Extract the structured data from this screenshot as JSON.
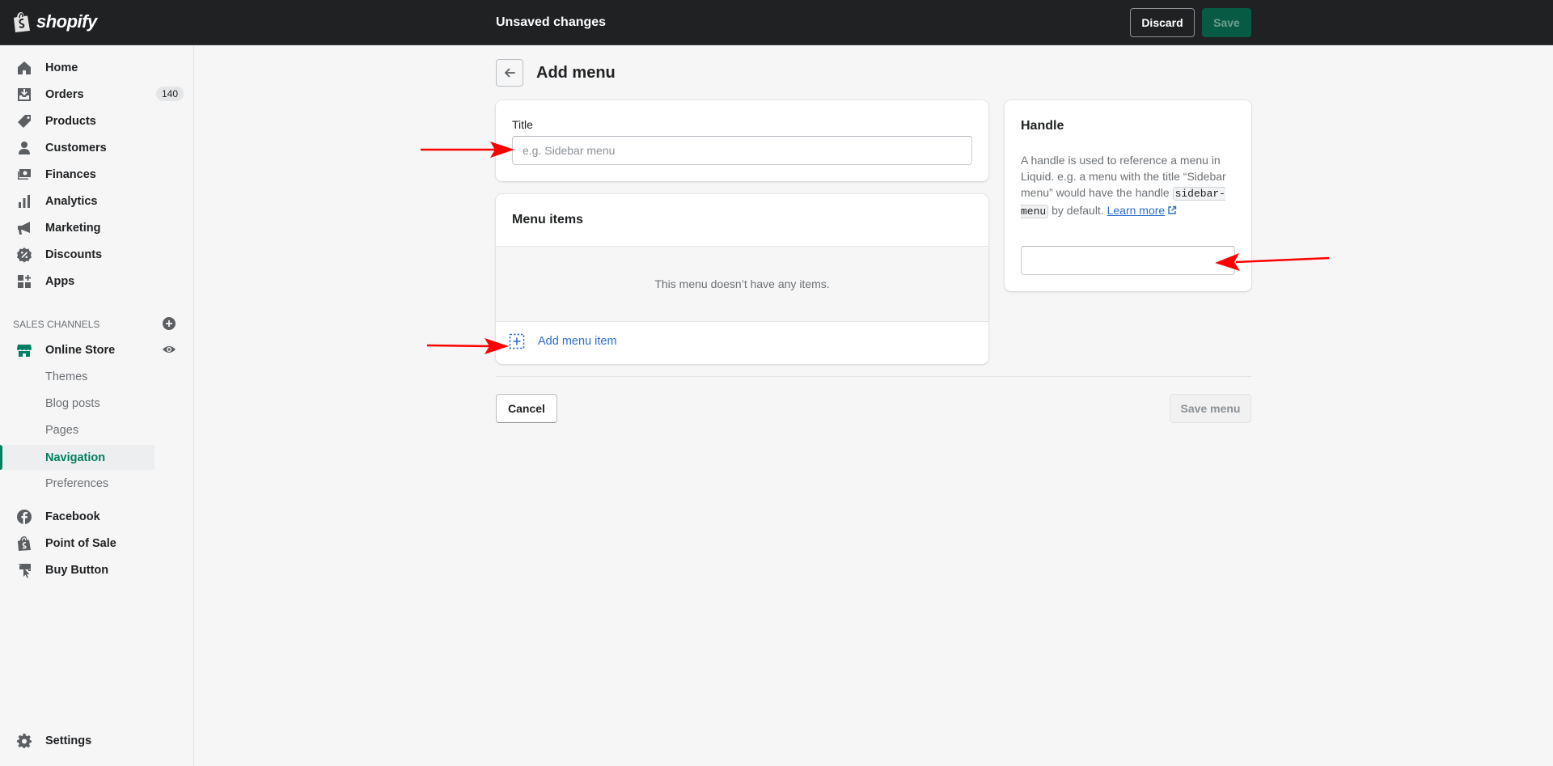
{
  "topbar": {
    "logo_text": "shopify",
    "status_text": "Unsaved changes",
    "discard_label": "Discard",
    "save_label": "Save"
  },
  "sidebar": {
    "items": [
      {
        "label": "Home",
        "icon": "home-icon"
      },
      {
        "label": "Orders",
        "icon": "orders-icon",
        "badge": "140"
      },
      {
        "label": "Products",
        "icon": "tag-icon"
      },
      {
        "label": "Customers",
        "icon": "person-icon"
      },
      {
        "label": "Finances",
        "icon": "finances-icon"
      },
      {
        "label": "Analytics",
        "icon": "bar-chart-icon"
      },
      {
        "label": "Marketing",
        "icon": "megaphone-icon"
      },
      {
        "label": "Discounts",
        "icon": "discount-icon"
      },
      {
        "label": "Apps",
        "icon": "apps-icon"
      }
    ],
    "sales_channels_title": "SALES CHANNELS",
    "online_store": {
      "label": "Online Store",
      "icon": "store-icon",
      "subitems": [
        "Themes",
        "Blog posts",
        "Pages",
        "Navigation",
        "Preferences"
      ],
      "active_subitem": "Navigation"
    },
    "channels": [
      {
        "label": "Facebook",
        "icon": "facebook-icon"
      },
      {
        "label": "Point of Sale",
        "icon": "pos-icon"
      },
      {
        "label": "Buy Button",
        "icon": "buy-button-icon"
      }
    ],
    "settings_label": "Settings"
  },
  "main": {
    "page_title": "Add menu",
    "title_card": {
      "label": "Title",
      "placeholder": "e.g. Sidebar menu",
      "value": ""
    },
    "menu_items_card": {
      "heading": "Menu items",
      "empty_text": "This menu doesn’t have any items.",
      "add_label": "Add menu item"
    },
    "handle_card": {
      "heading": "Handle",
      "desc_part1": "A handle is used to reference a menu in Liquid. e.g. a menu with the title “Sidebar menu” would have the handle",
      "code": "sidebar-menu",
      "desc_part2": "by default.",
      "learn_more": "Learn more",
      "value": ""
    },
    "cancel_label": "Cancel",
    "save_menu_label": "Save menu"
  },
  "colors": {
    "topbar_bg": "#202123",
    "accent_green": "#008060",
    "link_blue": "#2c6ecb",
    "annotation_red": "#ff0000"
  }
}
